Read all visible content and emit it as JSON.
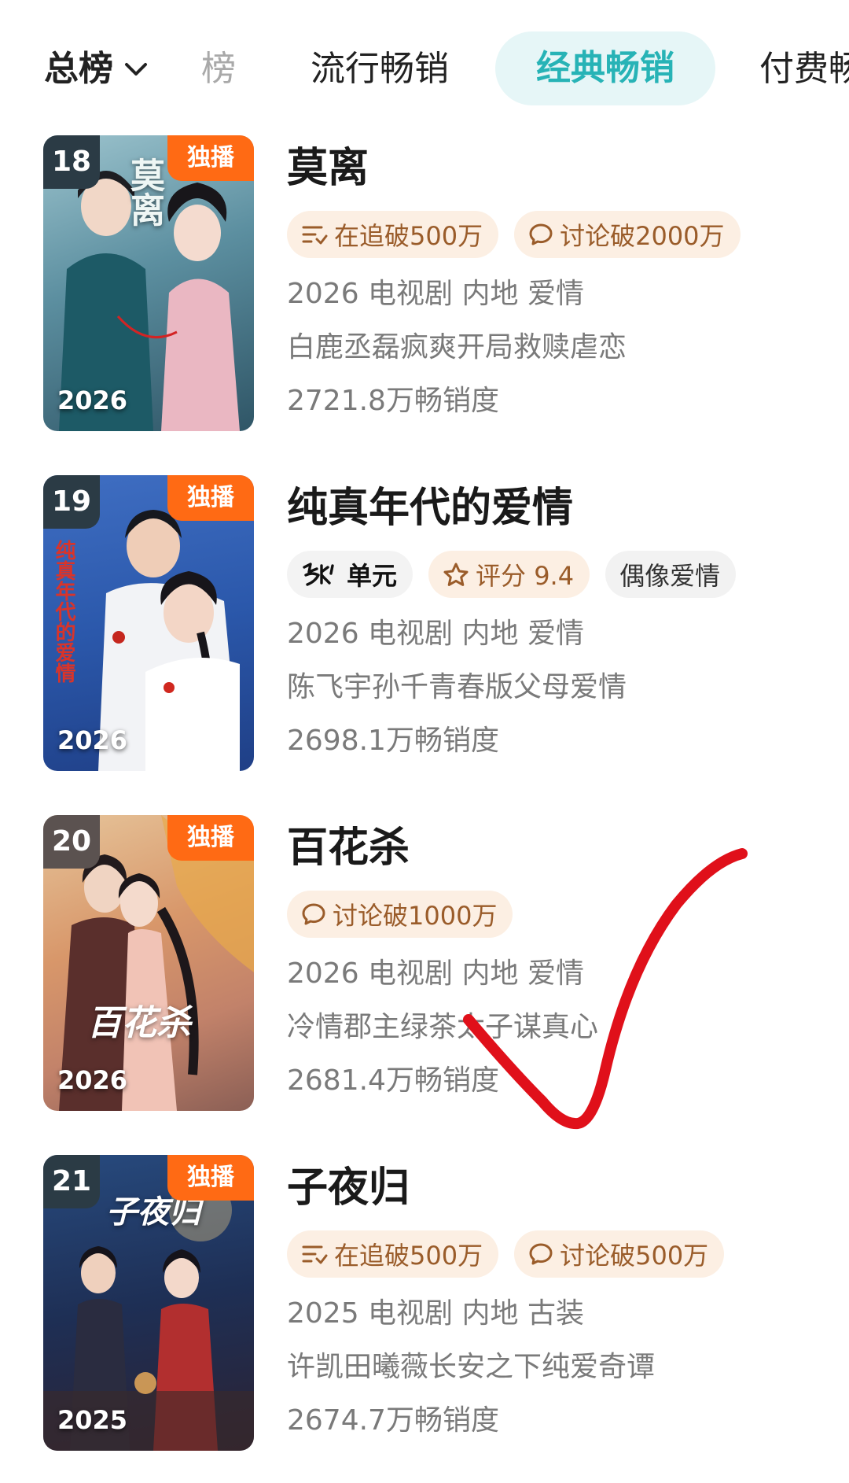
{
  "tabs": {
    "total": "总榜",
    "cut": "榜",
    "popular": "流行畅销",
    "classic": "经典畅销",
    "paid": "付费畅"
  },
  "items": [
    {
      "rank": "18",
      "badge": "独播",
      "poster_year": "2026",
      "poster_art": "莫离",
      "title": "莫离",
      "tags": [
        {
          "icon": "follow-list-icon",
          "text": "在追破500万"
        },
        {
          "icon": "chat-bubble-icon",
          "text": "讨论破2000万"
        }
      ],
      "info": "2026 电视剧 内地 爱情",
      "desc": "白鹿丞磊疯爽开局救赎虐恋",
      "sales": "2721.8万畅销度"
    },
    {
      "rank": "19",
      "badge": "独播",
      "poster_year": "2026",
      "poster_art": "纯真年代的爱情",
      "title": "纯真年代的爱情",
      "tags": [
        {
          "icon": "firefly-logo",
          "text": "单元"
        },
        {
          "icon": "star-icon",
          "text": "评分 9.4"
        },
        {
          "icon": "",
          "text": "偶像爱情"
        }
      ],
      "info": "2026 电视剧 内地 爱情",
      "desc": "陈飞宇孙千青春版父母爱情",
      "sales": "2698.1万畅销度"
    },
    {
      "rank": "20",
      "badge": "独播",
      "poster_year": "2026",
      "poster_art": "百花杀",
      "title": "百花杀",
      "tags": [
        {
          "icon": "chat-bubble-icon",
          "text": "讨论破1000万"
        }
      ],
      "info": "2026 电视剧 内地 爱情",
      "desc": "冷情郡主绿茶太子谋真心",
      "sales": "2681.4万畅销度"
    },
    {
      "rank": "21",
      "badge": "独播",
      "poster_year": "2025",
      "poster_art": "子夜归",
      "title": "子夜归",
      "tags": [
        {
          "icon": "follow-list-icon",
          "text": "在追破500万"
        },
        {
          "icon": "chat-bubble-icon",
          "text": "讨论破500万"
        }
      ],
      "info": "2025 电视剧 内地 古装",
      "desc": "许凯田曦薇长安之下纯爱奇谭",
      "sales": "2674.7万畅销度"
    }
  ],
  "colors": {
    "accent": "#27b3b6",
    "accent_bg": "#e6f6f7",
    "exclusive": "#ff6a14",
    "tag_bg": "#fcefe3",
    "tag_text": "#9a5c2a",
    "check": "#e0101a"
  }
}
